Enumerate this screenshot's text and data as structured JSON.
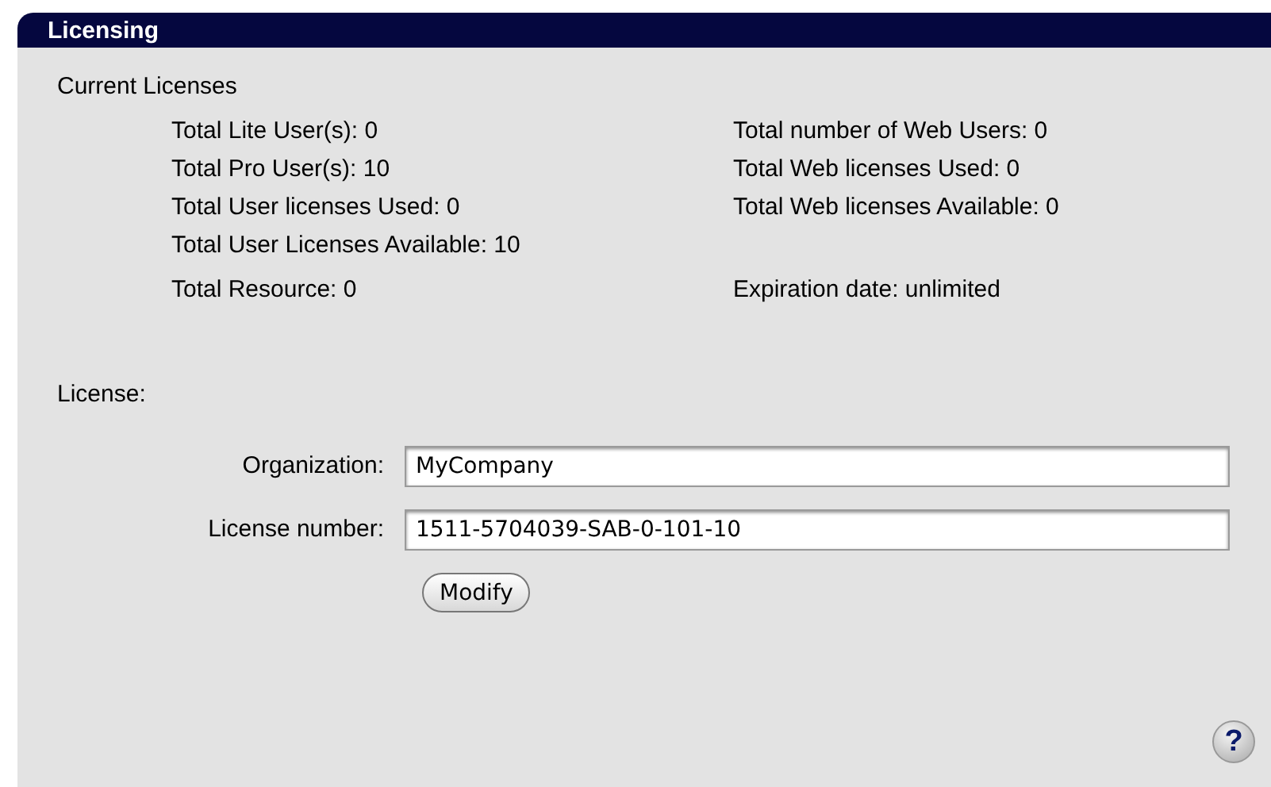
{
  "panel": {
    "title": "Licensing"
  },
  "current_licenses": {
    "heading": "Current Licenses",
    "left": [
      "Total Lite User(s): 0",
      "Total Pro User(s): 10",
      "Total User licenses Used: 0",
      "Total User Licenses Available: 10"
    ],
    "right": [
      "Total number of Web Users: 0",
      "Total Web licenses Used: 0",
      "Total Web licenses Available: 0"
    ],
    "resource": "Total Resource: 0",
    "expiration": "Expiration date: unlimited"
  },
  "license": {
    "heading": "License:",
    "fields": [
      {
        "label": "Organization:",
        "value": "MyCompany"
      },
      {
        "label": "License number:",
        "value": "1511-5704039-SAB-0-101-10"
      }
    ],
    "button": "Modify"
  },
  "help_button": "?"
}
